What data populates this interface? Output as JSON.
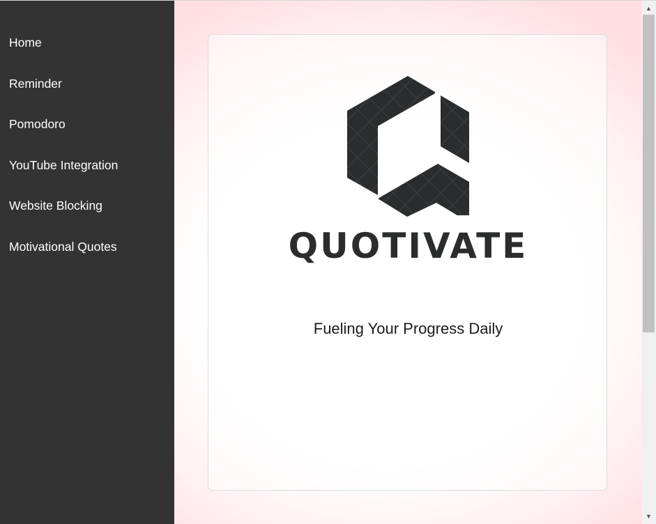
{
  "sidebar": {
    "items": [
      {
        "label": "Home"
      },
      {
        "label": "Reminder"
      },
      {
        "label": "Pomodoro"
      },
      {
        "label": "YouTube Integration"
      },
      {
        "label": "Website Blocking"
      },
      {
        "label": "Motivational Quotes"
      }
    ]
  },
  "main": {
    "brand_name": "QUOTIVATE",
    "tagline": "Fueling Your Progress Daily",
    "logo_icon": "quotivate-hexagon-logo-icon"
  },
  "colors": {
    "sidebar_bg": "#333333",
    "sidebar_text": "#ffffff",
    "logo": "#2b2c2e",
    "background_tint": "#ffdfe2"
  },
  "scrollbar": {
    "up_icon": "scroll-up-arrow-icon",
    "down_icon": "scroll-down-arrow-icon"
  }
}
